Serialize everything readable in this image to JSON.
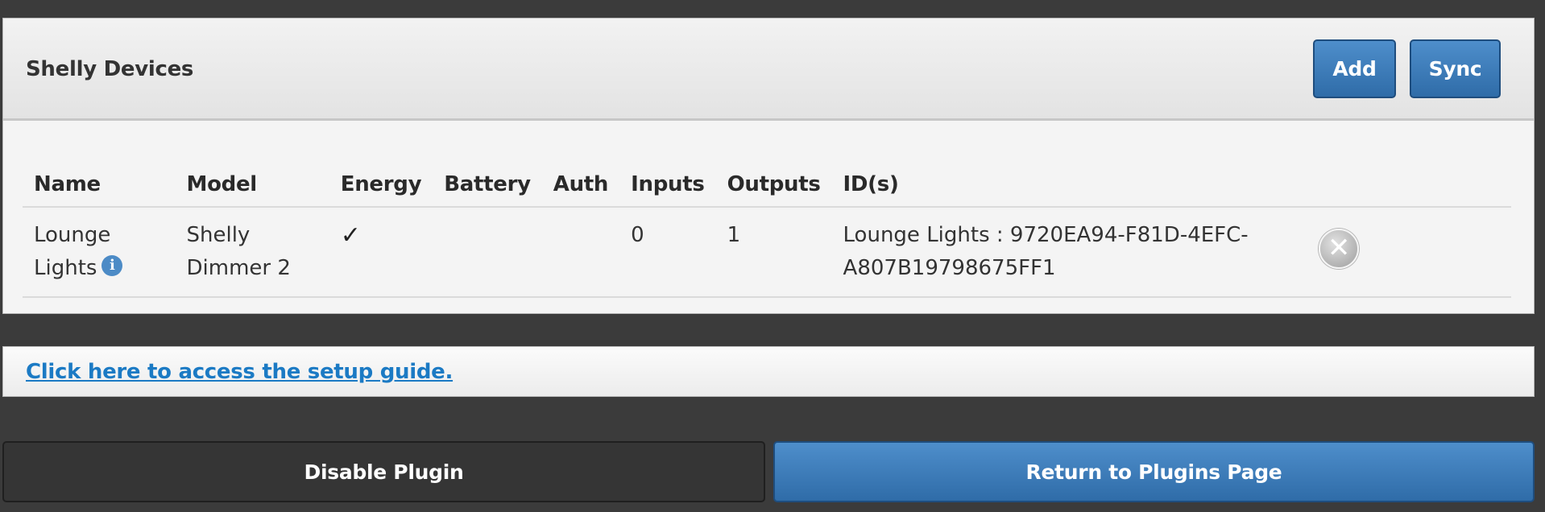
{
  "panel": {
    "title": "Shelly Devices",
    "add_label": "Add",
    "sync_label": "Sync"
  },
  "table": {
    "headers": [
      "Name",
      "Model",
      "Energy",
      "Battery",
      "Auth",
      "Inputs",
      "Outputs",
      "ID(s)"
    ],
    "rows": [
      {
        "name": "Lounge Lights",
        "info_icon": "info-icon",
        "model": "Shelly Dimmer 2",
        "energy": "✓",
        "battery": "",
        "auth": "",
        "inputs": "0",
        "outputs": "1",
        "ids": "Lounge Lights : 9720EA94-F81D-4EFC-A807B19798675FF1",
        "remove_icon": "remove-icon"
      }
    ]
  },
  "guide": {
    "link_text": "Click here to access the setup guide."
  },
  "footer": {
    "disable_label": "Disable Plugin",
    "return_label": "Return to Plugins Page"
  },
  "colors": {
    "accent_blue": "#3a7ab8",
    "link_blue": "#1b7ac4",
    "background": "#3b3b3b"
  }
}
